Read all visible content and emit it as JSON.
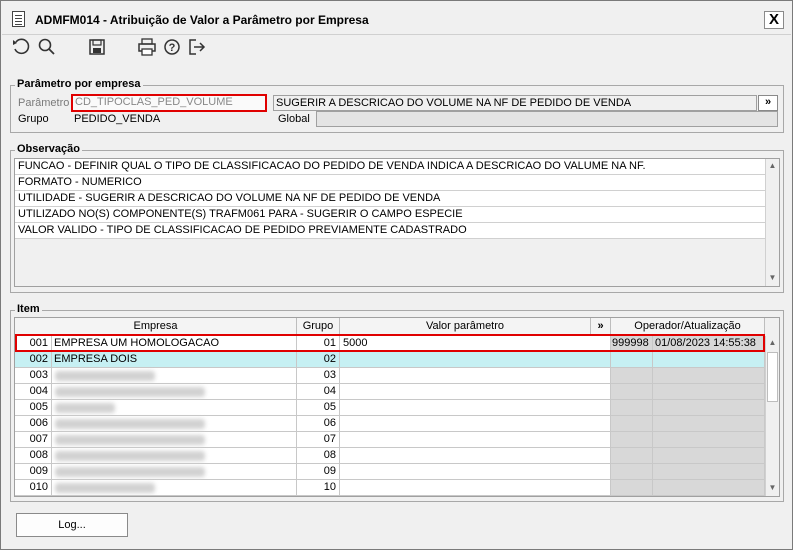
{
  "window": {
    "title": "ADMFM014 - Atribuição de Valor a Parâmetro por Empresa",
    "close_label": "X"
  },
  "toolbar": {
    "icons": [
      "refresh-icon",
      "search-icon",
      "save-icon",
      "print-icon",
      "help-icon",
      "exit-icon"
    ],
    "help_glyph": "?"
  },
  "param_section": {
    "legend": "Parâmetro por empresa",
    "parametro_label": "Parâmetro",
    "parametro_value": "CD_TIPOCLAS_PED_VOLUME",
    "parametro_desc": "SUGERIR A DESCRICAO DO VOLUME NA NF DE PEDIDO DE VENDA",
    "more_label": "»",
    "grupo_label": "Grupo",
    "grupo_value": "PEDIDO_VENDA",
    "global_label": "Global",
    "global_value": ""
  },
  "obs_section": {
    "legend": "Observação",
    "lines": [
      "FUNCAO - DEFINIR QUAL O TIPO DE CLASSIFICACAO DO PEDIDO DE VENDA INDICA A DESCRICAO DO VALUME NA NF.",
      "FORMATO - NUMERICO",
      "UTILIDADE - SUGERIR A DESCRICAO DO VOLUME NA NF DE PEDIDO DE VENDA",
      "UTILIZADO NO(S) COMPONENTE(S) TRAFM061  PARA  - SUGERIR O CAMPO ESPECIE",
      "VALOR VALIDO - TIPO DE CLASSIFICACAO DE PEDIDO PREVIAMENTE CADASTRADO"
    ]
  },
  "item_section": {
    "legend": "Item",
    "columns": {
      "empresa": "Empresa",
      "grupo": "Grupo",
      "valor": "Valor parâmetro",
      "more": "»",
      "operador": "Operador/Atualização"
    },
    "rows": [
      {
        "code": "001",
        "empresa": "EMPRESA UM HOMOLOGACAO",
        "grupo": "01",
        "valor": "5000",
        "operador": "999998",
        "data": "01/08/2023 14:55:38"
      },
      {
        "code": "002",
        "empresa": "EMPRESA DOIS",
        "grupo": "02",
        "valor": "",
        "operador": "",
        "data": ""
      },
      {
        "code": "003",
        "empresa": "",
        "grupo": "03",
        "valor": "",
        "operador": "",
        "data": ""
      },
      {
        "code": "004",
        "empresa": "",
        "grupo": "04",
        "valor": "",
        "operador": "",
        "data": ""
      },
      {
        "code": "005",
        "empresa": "",
        "grupo": "05",
        "valor": "",
        "operador": "",
        "data": ""
      },
      {
        "code": "006",
        "empresa": "",
        "grupo": "06",
        "valor": "",
        "operador": "",
        "data": ""
      },
      {
        "code": "007",
        "empresa": "",
        "grupo": "07",
        "valor": "",
        "operador": "",
        "data": ""
      },
      {
        "code": "008",
        "empresa": "",
        "grupo": "08",
        "valor": "",
        "operador": "",
        "data": ""
      },
      {
        "code": "009",
        "empresa": "",
        "grupo": "09",
        "valor": "",
        "operador": "",
        "data": ""
      },
      {
        "code": "010",
        "empresa": "",
        "grupo": "10",
        "valor": "",
        "operador": "",
        "data": ""
      }
    ]
  },
  "footer": {
    "log_label": "Log..."
  }
}
